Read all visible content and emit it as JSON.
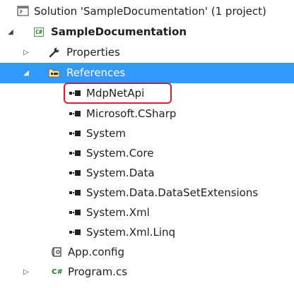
{
  "solution": {
    "label": "Solution 'SampleDocumentation' (1 project)",
    "icon": "solution-icon"
  },
  "project": {
    "label": "SampleDocumentation",
    "icon": "csharp-project-icon",
    "badge": "C#"
  },
  "items": {
    "properties": {
      "label": "Properties",
      "icon": "wrench-icon"
    },
    "references": {
      "label": "References",
      "icon": "references-folder-icon"
    },
    "app_config": {
      "label": "App.config",
      "icon": "config-file-icon"
    },
    "program_cs": {
      "label": "Program.cs",
      "icon": "csharp-file-icon",
      "badge": "C#"
    }
  },
  "references": [
    "MdpNetApi",
    "Microsoft.CSharp",
    "System",
    "System.Core",
    "System.Data",
    "System.Data.DataSetExtensions",
    "System.Xml",
    "System.Xml.Linq"
  ],
  "colors": {
    "selection": "#3399ff",
    "highlight": "#d21f2a"
  }
}
